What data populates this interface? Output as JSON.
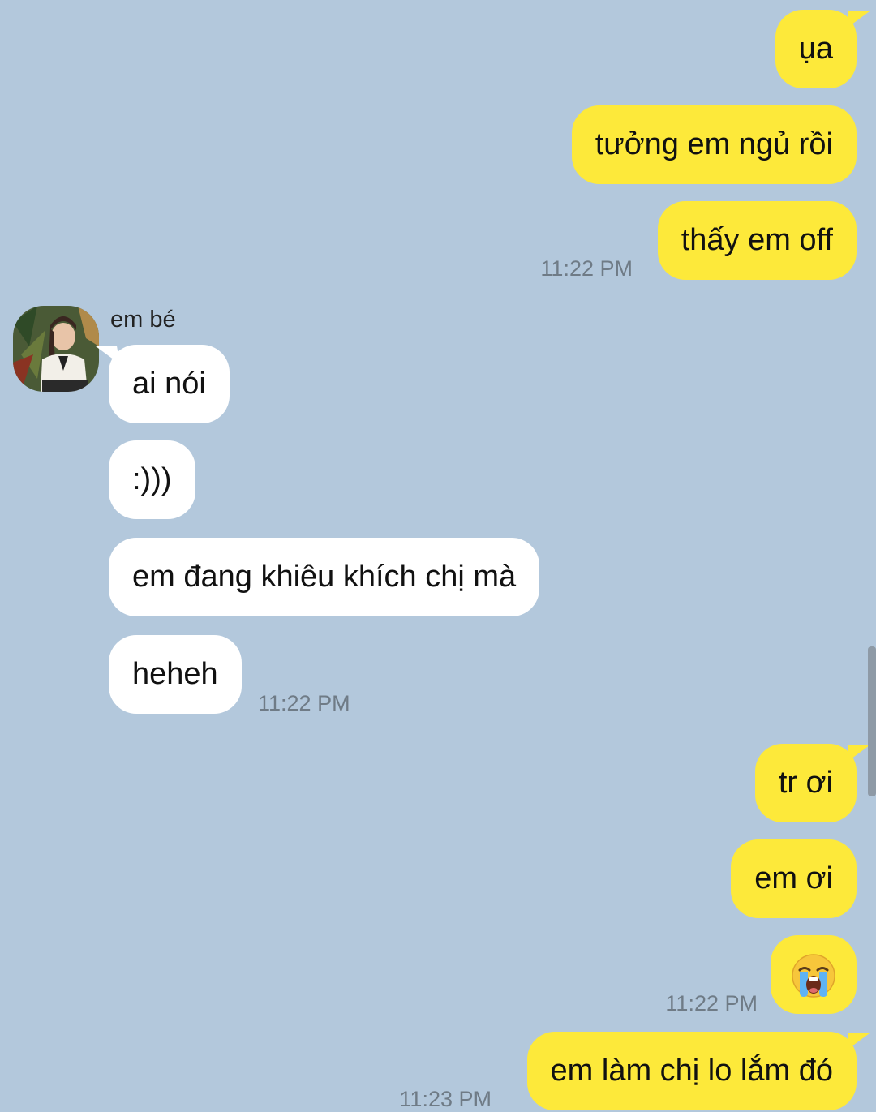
{
  "messages": [
    {
      "text": "ụa"
    },
    {
      "text": "tưởng em ngủ rồi"
    },
    {
      "text": "thấy em off"
    },
    {
      "text": "ai nói"
    },
    {
      "text": ":)))"
    },
    {
      "text": "em đang khiêu khích chị mà"
    },
    {
      "text": "heheh"
    },
    {
      "text": "tr ơi"
    },
    {
      "text": "em ơi"
    },
    {
      "emoji": "loudly-crying-face"
    },
    {
      "text": "em làm chị lo lắm đó"
    }
  ],
  "timestamps": [
    "11:22 PM",
    "11:22 PM",
    "11:22 PM",
    "11:23 PM"
  ],
  "sender_name": "em bé",
  "colors": {
    "background": "#b3c8dc",
    "outgoing_bubble": "#fde93a",
    "incoming_bubble": "#ffffff",
    "timestamp": "#6f7b86"
  }
}
